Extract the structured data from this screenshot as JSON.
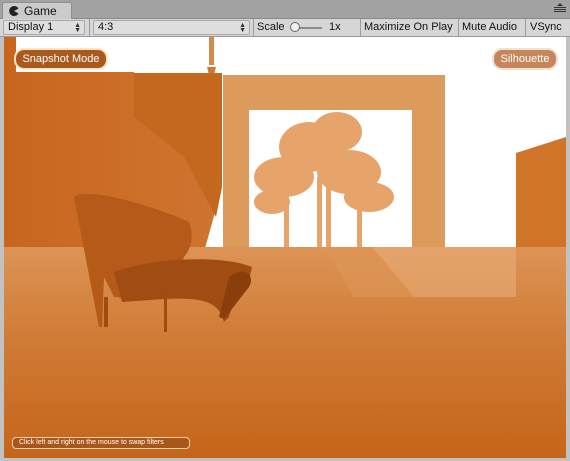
{
  "tab": {
    "label": "Game",
    "icon": "pacman-icon"
  },
  "toolbar": {
    "display": "Display 1",
    "aspect": "4:3",
    "scale_label": "Scale",
    "scale_value": "1x",
    "maximize": "Maximize On Play",
    "mute": "Mute Audio",
    "vsync": "VSync"
  },
  "game": {
    "snapshot_button": "Snapshot Mode",
    "silhouette_button": "Silhouette",
    "hint": "Click left and right on the mouse to swap filters",
    "tint_color": "#c96a22"
  },
  "colors": {
    "tab_strip": "#a2a2a2",
    "toolbar": "#d6d6d6"
  }
}
